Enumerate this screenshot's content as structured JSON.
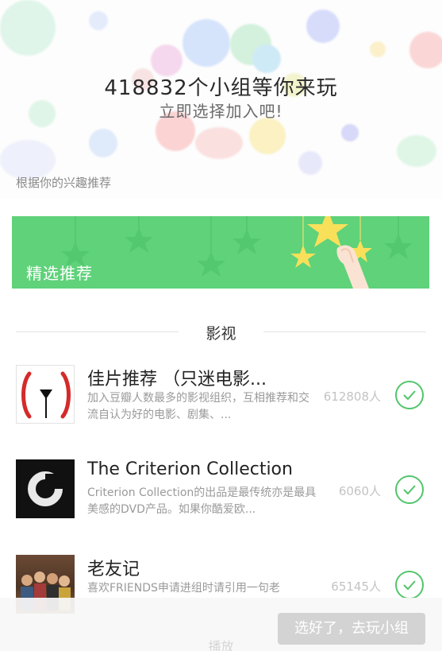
{
  "hero": {
    "title": "418832个小组等你来玩",
    "subtitle": "立即选择加入吧!"
  },
  "hint": "根据你的兴趣推荐",
  "banner": {
    "label": "精选推荐"
  },
  "section": {
    "title": "影视"
  },
  "groups": [
    {
      "title": "佳片推荐 （只迷电影...",
      "desc": "加入豆瓣人数最多的影视组织，互相推荐和交流自认为好的电影、剧集、...",
      "count": "612808人",
      "selected": true,
      "thumb_icon": "film-icon"
    },
    {
      "title": "The Criterion Collection",
      "desc": "Criterion Collection的出品是最传统亦是最具美感的DVD产品。如果你酷爱欧...",
      "count": "6060人",
      "selected": true,
      "thumb_icon": "criterion-logo-icon"
    },
    {
      "title": "老友记",
      "desc": "喜欢FRIENDS申请进组时请引用一句老",
      "count": "65145人",
      "selected": true,
      "thumb_icon": "friends-photo"
    }
  ],
  "footer": {
    "ghost_label": "播放",
    "done_label": "选好了，去玩小组"
  },
  "colors": {
    "accent": "#5fd27a",
    "check": "#52c56b",
    "button_disabled": "#d3d3d3"
  }
}
